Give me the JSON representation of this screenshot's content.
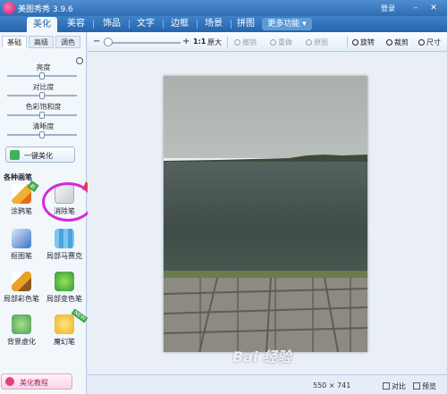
{
  "app": {
    "title": "美图秀秀 3.9.6",
    "login": "登录"
  },
  "window": {
    "minimize": "–",
    "close": "✕"
  },
  "main_tabs": [
    {
      "label": "美化",
      "active": true
    },
    {
      "label": "美容"
    },
    {
      "label": "饰品"
    },
    {
      "label": "文字"
    },
    {
      "label": "边框"
    },
    {
      "label": "场景"
    },
    {
      "label": "拼图"
    }
  ],
  "more_tab": {
    "label": "更多功能 ▾"
  },
  "left_panel": {
    "subtabs": [
      {
        "label": "基础",
        "active": true
      },
      {
        "label": "高级"
      },
      {
        "label": "调色"
      }
    ],
    "sliders": [
      {
        "label": "亮度",
        "value": 0.5
      },
      {
        "label": "对比度",
        "value": 0.5
      },
      {
        "label": "色彩饱和度",
        "value": 0.5
      },
      {
        "label": "清晰度",
        "value": 0.5
      }
    ],
    "one_key_label": "一键美化",
    "section_title": "各种画笔",
    "tools": [
      {
        "label": "涂鸦笔",
        "icon": "pencil-icon",
        "badge": "新"
      },
      {
        "label": "消除笔",
        "icon": "eraser-icon"
      },
      {
        "label": "抠图笔",
        "icon": "cutout-pen-icon"
      },
      {
        "label": "局部马赛克",
        "icon": "mosaic-icon"
      },
      {
        "label": "局部彩色笔",
        "icon": "color-brush-icon"
      },
      {
        "label": "局部变色笔",
        "icon": "color-change-icon"
      },
      {
        "label": "背景虚化",
        "icon": "blur-icon"
      },
      {
        "label": "魔幻笔",
        "icon": "magic-pen-icon",
        "badge": "NEW"
      }
    ],
    "tutorial_label": "美化教程"
  },
  "toolbar": {
    "zoom_label": "1:1",
    "original_size": "原大",
    "undo": "撤销",
    "redo": "重做",
    "reset": "原图",
    "rotate": "旋转",
    "crop": "裁剪",
    "resize": "尺寸"
  },
  "status": {
    "dimensions": "550 × 741",
    "compare": "对比",
    "preview": "预览"
  },
  "watermark": "Bai 经验",
  "colors": {
    "titlebar": "#2e6cb4",
    "highlight": "#d62ad6",
    "arrow": "#e23a4a"
  }
}
